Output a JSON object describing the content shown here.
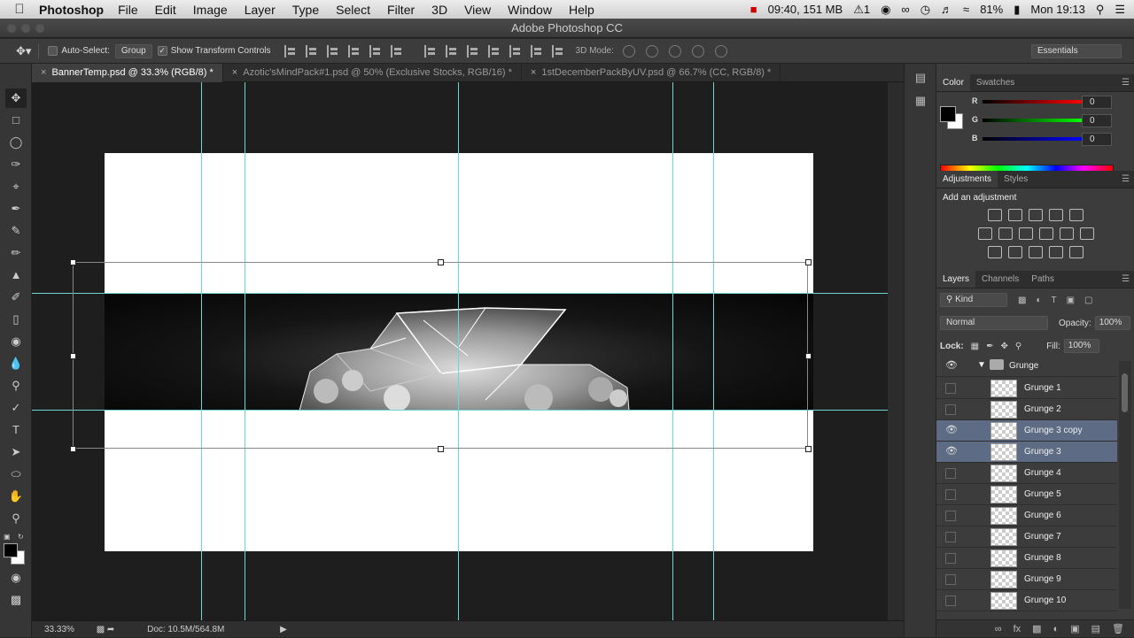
{
  "menubar": {
    "app_name": "Photoshop",
    "items": [
      "File",
      "Edit",
      "Image",
      "Layer",
      "Type",
      "Select",
      "Filter",
      "3D",
      "View",
      "Window",
      "Help"
    ],
    "status": {
      "recording": "09:40, 151 MB",
      "notifications": "1",
      "volume_icon": "volume-icon",
      "battery": "81%",
      "clock": "Mon 19:13"
    }
  },
  "window": {
    "title": "Adobe Photoshop CC"
  },
  "options_bar": {
    "auto_select_label": "Auto-Select:",
    "auto_select_value": "Group",
    "show_transform_label": "Show Transform Controls",
    "mode_3d_label": "3D Mode:",
    "workspace": "Essentials"
  },
  "document_tabs": [
    {
      "label": "BannerTemp.psd @ 33.3% (RGB/8) *",
      "active": true
    },
    {
      "label": "Azotic'sMindPack#1.psd @ 50% (Exclusive Stocks, RGB/16) *",
      "active": false
    },
    {
      "label": "1stDecemberPackByUV.psd @ 66.7% (CC, RGB/8) *",
      "active": false
    }
  ],
  "status_bar": {
    "zoom": "33.33%",
    "doc_size": "Doc: 10.5M/564.8M"
  },
  "color_panel": {
    "tabs": [
      "Color",
      "Swatches"
    ],
    "channels": [
      {
        "label": "R",
        "value": "0"
      },
      {
        "label": "G",
        "value": "0"
      },
      {
        "label": "B",
        "value": "0"
      }
    ],
    "foreground": "#000000",
    "background": "#ffffff"
  },
  "adjustments_panel": {
    "tabs": [
      "Adjustments",
      "Styles"
    ],
    "title": "Add an adjustment"
  },
  "layers_panel": {
    "tabs": [
      "Layers",
      "Channels",
      "Paths"
    ],
    "filter_kind": "Kind",
    "blend_mode": "Normal",
    "opacity_label": "Opacity:",
    "opacity": "100%",
    "lock_label": "Lock:",
    "fill_label": "Fill:",
    "fill": "100%",
    "group": {
      "name": "Grunge",
      "visible": true,
      "expanded": true
    },
    "layers": [
      {
        "name": "Grunge 1",
        "visible": false,
        "selected": false
      },
      {
        "name": "Grunge 2",
        "visible": false,
        "selected": false
      },
      {
        "name": "Grunge 3 copy",
        "visible": true,
        "selected": true
      },
      {
        "name": "Grunge 3",
        "visible": true,
        "selected": true
      },
      {
        "name": "Grunge 4",
        "visible": false,
        "selected": false
      },
      {
        "name": "Grunge 5",
        "visible": false,
        "selected": false
      },
      {
        "name": "Grunge 6",
        "visible": false,
        "selected": false
      },
      {
        "name": "Grunge 7",
        "visible": false,
        "selected": false
      },
      {
        "name": "Grunge 8",
        "visible": false,
        "selected": false
      },
      {
        "name": "Grunge 9",
        "visible": false,
        "selected": false
      },
      {
        "name": "Grunge 10",
        "visible": false,
        "selected": false
      }
    ]
  },
  "colors": {
    "guide": "#6fd6d6",
    "selection": "#5d6c84",
    "canvas_bg": "#1e1e1e"
  }
}
